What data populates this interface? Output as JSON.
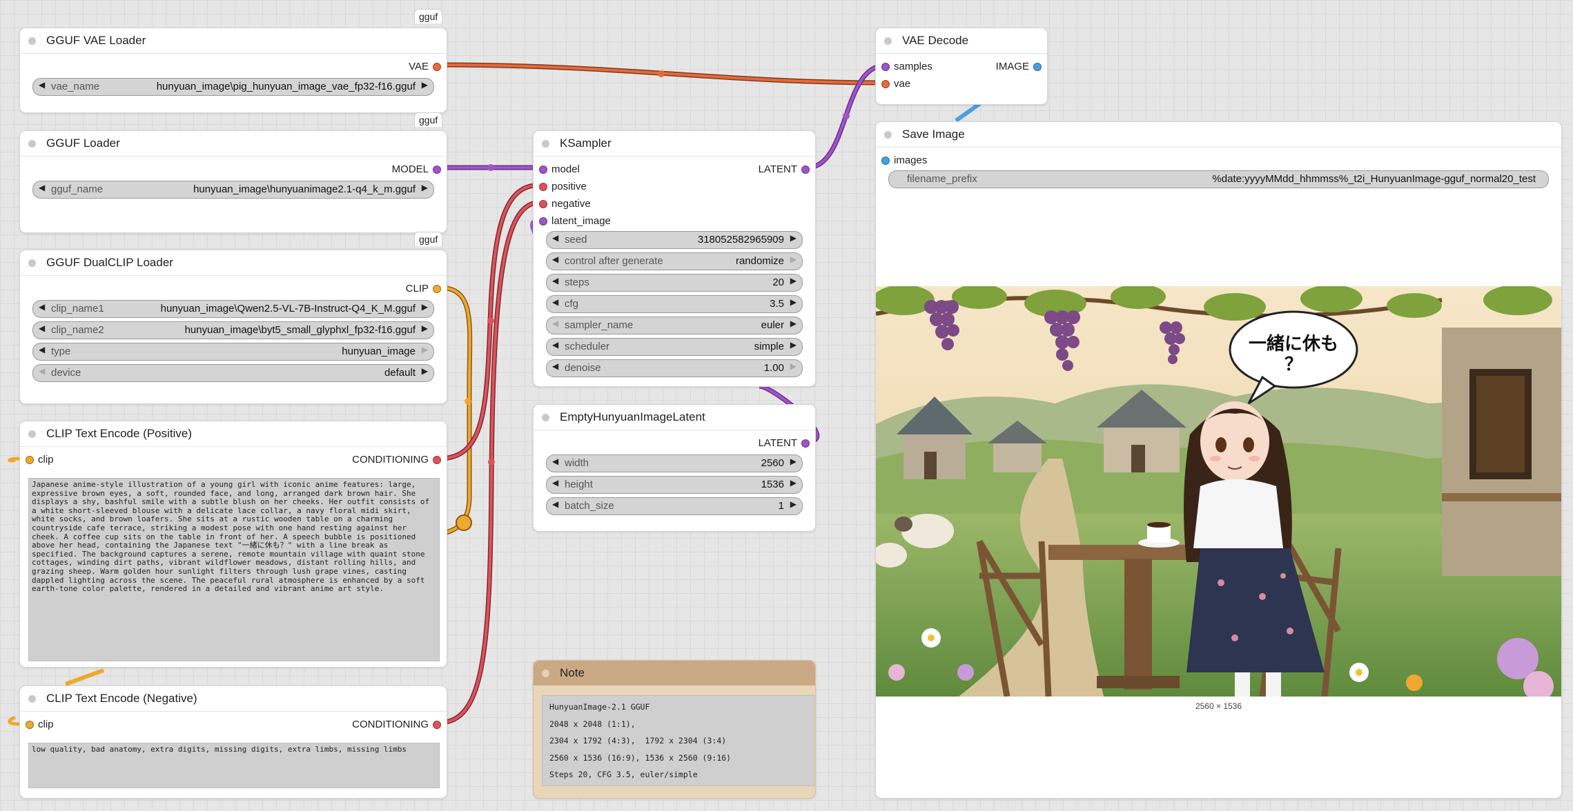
{
  "colors": {
    "vae": "#e8693a",
    "model": "#a154c8",
    "clip": "#f0a830",
    "conditioning": "#e0525a",
    "latent": "#a154c8",
    "image": "#4a9fe0",
    "background": "#e6e6e6",
    "note": "#e9d5b8"
  },
  "nodes": {
    "vae_loader": {
      "badge": "gguf",
      "title": "GGUF VAE Loader",
      "output": "VAE",
      "widgets": [
        {
          "name": "vae_name",
          "value": "hunyuan_image\\pig_hunyuan_image_vae_fp32-f16.gguf"
        }
      ]
    },
    "gguf_loader": {
      "badge": "gguf",
      "title": "GGUF Loader",
      "output": "MODEL",
      "widgets": [
        {
          "name": "gguf_name",
          "value": "hunyuan_image\\hunyuanimage2.1-q4_k_m.gguf"
        }
      ]
    },
    "dualclip_loader": {
      "badge": "gguf",
      "title": "GGUF DualCLIP Loader",
      "output": "CLIP",
      "widgets": [
        {
          "name": "clip_name1",
          "value": "hunyuan_image\\Qwen2.5-VL-7B-Instruct-Q4_K_M.gguf"
        },
        {
          "name": "clip_name2",
          "value": "hunyuan_image\\byt5_small_glyphxl_fp32-f16.gguf"
        },
        {
          "name": "type",
          "value": "hunyuan_image"
        },
        {
          "name": "device",
          "value": "default"
        }
      ]
    },
    "clip_positive": {
      "title": "CLIP Text Encode (Positive)",
      "input": "clip",
      "output": "CONDITIONING",
      "text": "Japanese anime-style illustration of a young girl with iconic anime features: large, expressive brown eyes, a soft, rounded face, and long, arranged dark brown hair. She displays a shy, bashful smile with a subtle blush on her cheeks. Her outfit consists of a white short-sleeved blouse with a delicate lace collar, a navy floral midi skirt, white socks, and brown loafers. She sits at a rustic wooden table on a charming countryside cafe terrace, striking a modest pose with one hand resting against her cheek. A coffee cup sits on the table in front of her. A speech bubble is positioned above her head, containing the Japanese text \"一緒に休も？\" with a line break as specified. The background captures a serene, remote mountain village with quaint stone cottages, winding dirt paths, vibrant wildflower meadows, distant rolling hills, and grazing sheep. Warm golden hour sunlight filters through lush grape vines, casting dappled lighting across the scene. The peaceful rural atmosphere is enhanced by a soft earth-tone color palette, rendered in a detailed and vibrant anime art style."
    },
    "clip_negative": {
      "title": "CLIP Text Encode (Negative)",
      "input": "clip",
      "output": "CONDITIONING",
      "text": "low quality, bad anatomy, extra digits, missing digits, extra limbs, missing limbs"
    },
    "ksampler": {
      "title": "KSampler",
      "inputs": [
        "model",
        "positive",
        "negative",
        "latent_image"
      ],
      "output": "LATENT",
      "widgets": [
        {
          "name": "seed",
          "value": "318052582965909"
        },
        {
          "name": "control after generate",
          "value": "randomize"
        },
        {
          "name": "steps",
          "value": "20"
        },
        {
          "name": "cfg",
          "value": "3.5"
        },
        {
          "name": "sampler_name",
          "value": "euler"
        },
        {
          "name": "scheduler",
          "value": "simple"
        },
        {
          "name": "denoise",
          "value": "1.00"
        }
      ]
    },
    "empty_latent": {
      "title": "EmptyHunyuanImageLatent",
      "output": "LATENT",
      "widgets": [
        {
          "name": "width",
          "value": "2560"
        },
        {
          "name": "height",
          "value": "1536"
        },
        {
          "name": "batch_size",
          "value": "1"
        }
      ]
    },
    "note": {
      "title": "Note",
      "lines": [
        "HunyuanImage-2.1 GGUF",
        "2048 x 2048 (1:1),",
        "2304 x 1792 (4:3),  1792 x 2304 (3:4)",
        "2560 x 1536 (16:9), 1536 x 2560 (9:16)",
        "Steps 20, CFG 3.5, euler/simple"
      ]
    },
    "vae_decode": {
      "title": "VAE Decode",
      "inputs": [
        "samples",
        "vae"
      ],
      "output": "IMAGE"
    },
    "save_image": {
      "title": "Save Image",
      "input": "images",
      "widgets": [
        {
          "name": "filename_prefix",
          "value": "%date:yyyyMMdd_hhmmss%_t2i_HunyuanImage-gguf_normal20_test"
        }
      ],
      "speech_bubble_line1": "一緒に休も",
      "speech_bubble_line2": "？",
      "image_size_caption": "2560 × 1536"
    }
  }
}
